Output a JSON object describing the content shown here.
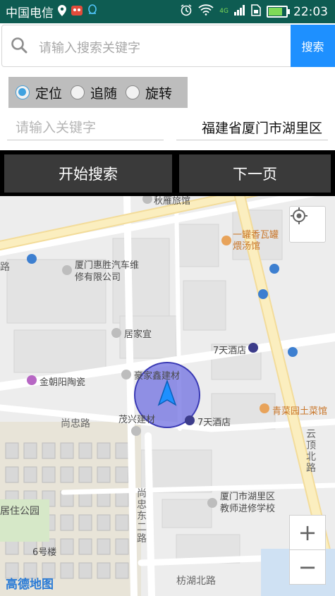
{
  "status_bar": {
    "carrier": "中国电信",
    "network": "4G",
    "time": "22:03",
    "icons": [
      "location-pin-icon",
      "app-notification-icon",
      "qq-icon",
      "alarm-icon",
      "wifi-icon",
      "signal-icon",
      "sim-icon",
      "battery-icon"
    ],
    "battery_level": 0.8
  },
  "search": {
    "placeholder": "请输入搜索关键字",
    "value": "",
    "button_label": "搜索"
  },
  "modes": [
    {
      "label": "定位",
      "selected": true
    },
    {
      "label": "追随",
      "selected": false
    },
    {
      "label": "旋转",
      "selected": false
    }
  ],
  "keyword": {
    "placeholder": "请输入关键字",
    "value": ""
  },
  "city": {
    "value": "福建省厦门市湖里区"
  },
  "buttons": {
    "start_search": "开始搜索",
    "next_page": "下一页"
  },
  "map": {
    "labels": {
      "hotel_top": "秋雁旅馆",
      "restaurant": "一罐香瓦罐煨汤馆",
      "repair": "厦门惠胜汽车维修有限公司",
      "juja": "居家宜",
      "seven_days_1": "7天酒店",
      "haojia": "豪家鑫建材",
      "jinchaoyang": "金朝阳陶瓷",
      "maoxing": "茂兴建材",
      "seven_days_2": "7天酒店",
      "qingcai": "青菜园土菜馆",
      "shangzhong_road": "尚忠路",
      "yunding_north": "云顶北路",
      "shangzhong_east": "尚忠东二路",
      "school": "厦门市湖里区教师进修学校",
      "park": "居住公园",
      "building6": "6号楼",
      "fanghu_north": "枋湖北路",
      "road_left": "路"
    },
    "logo": "高德地图",
    "zoom_in": "+",
    "zoom_out": "−",
    "accent": "#1e90ff"
  }
}
